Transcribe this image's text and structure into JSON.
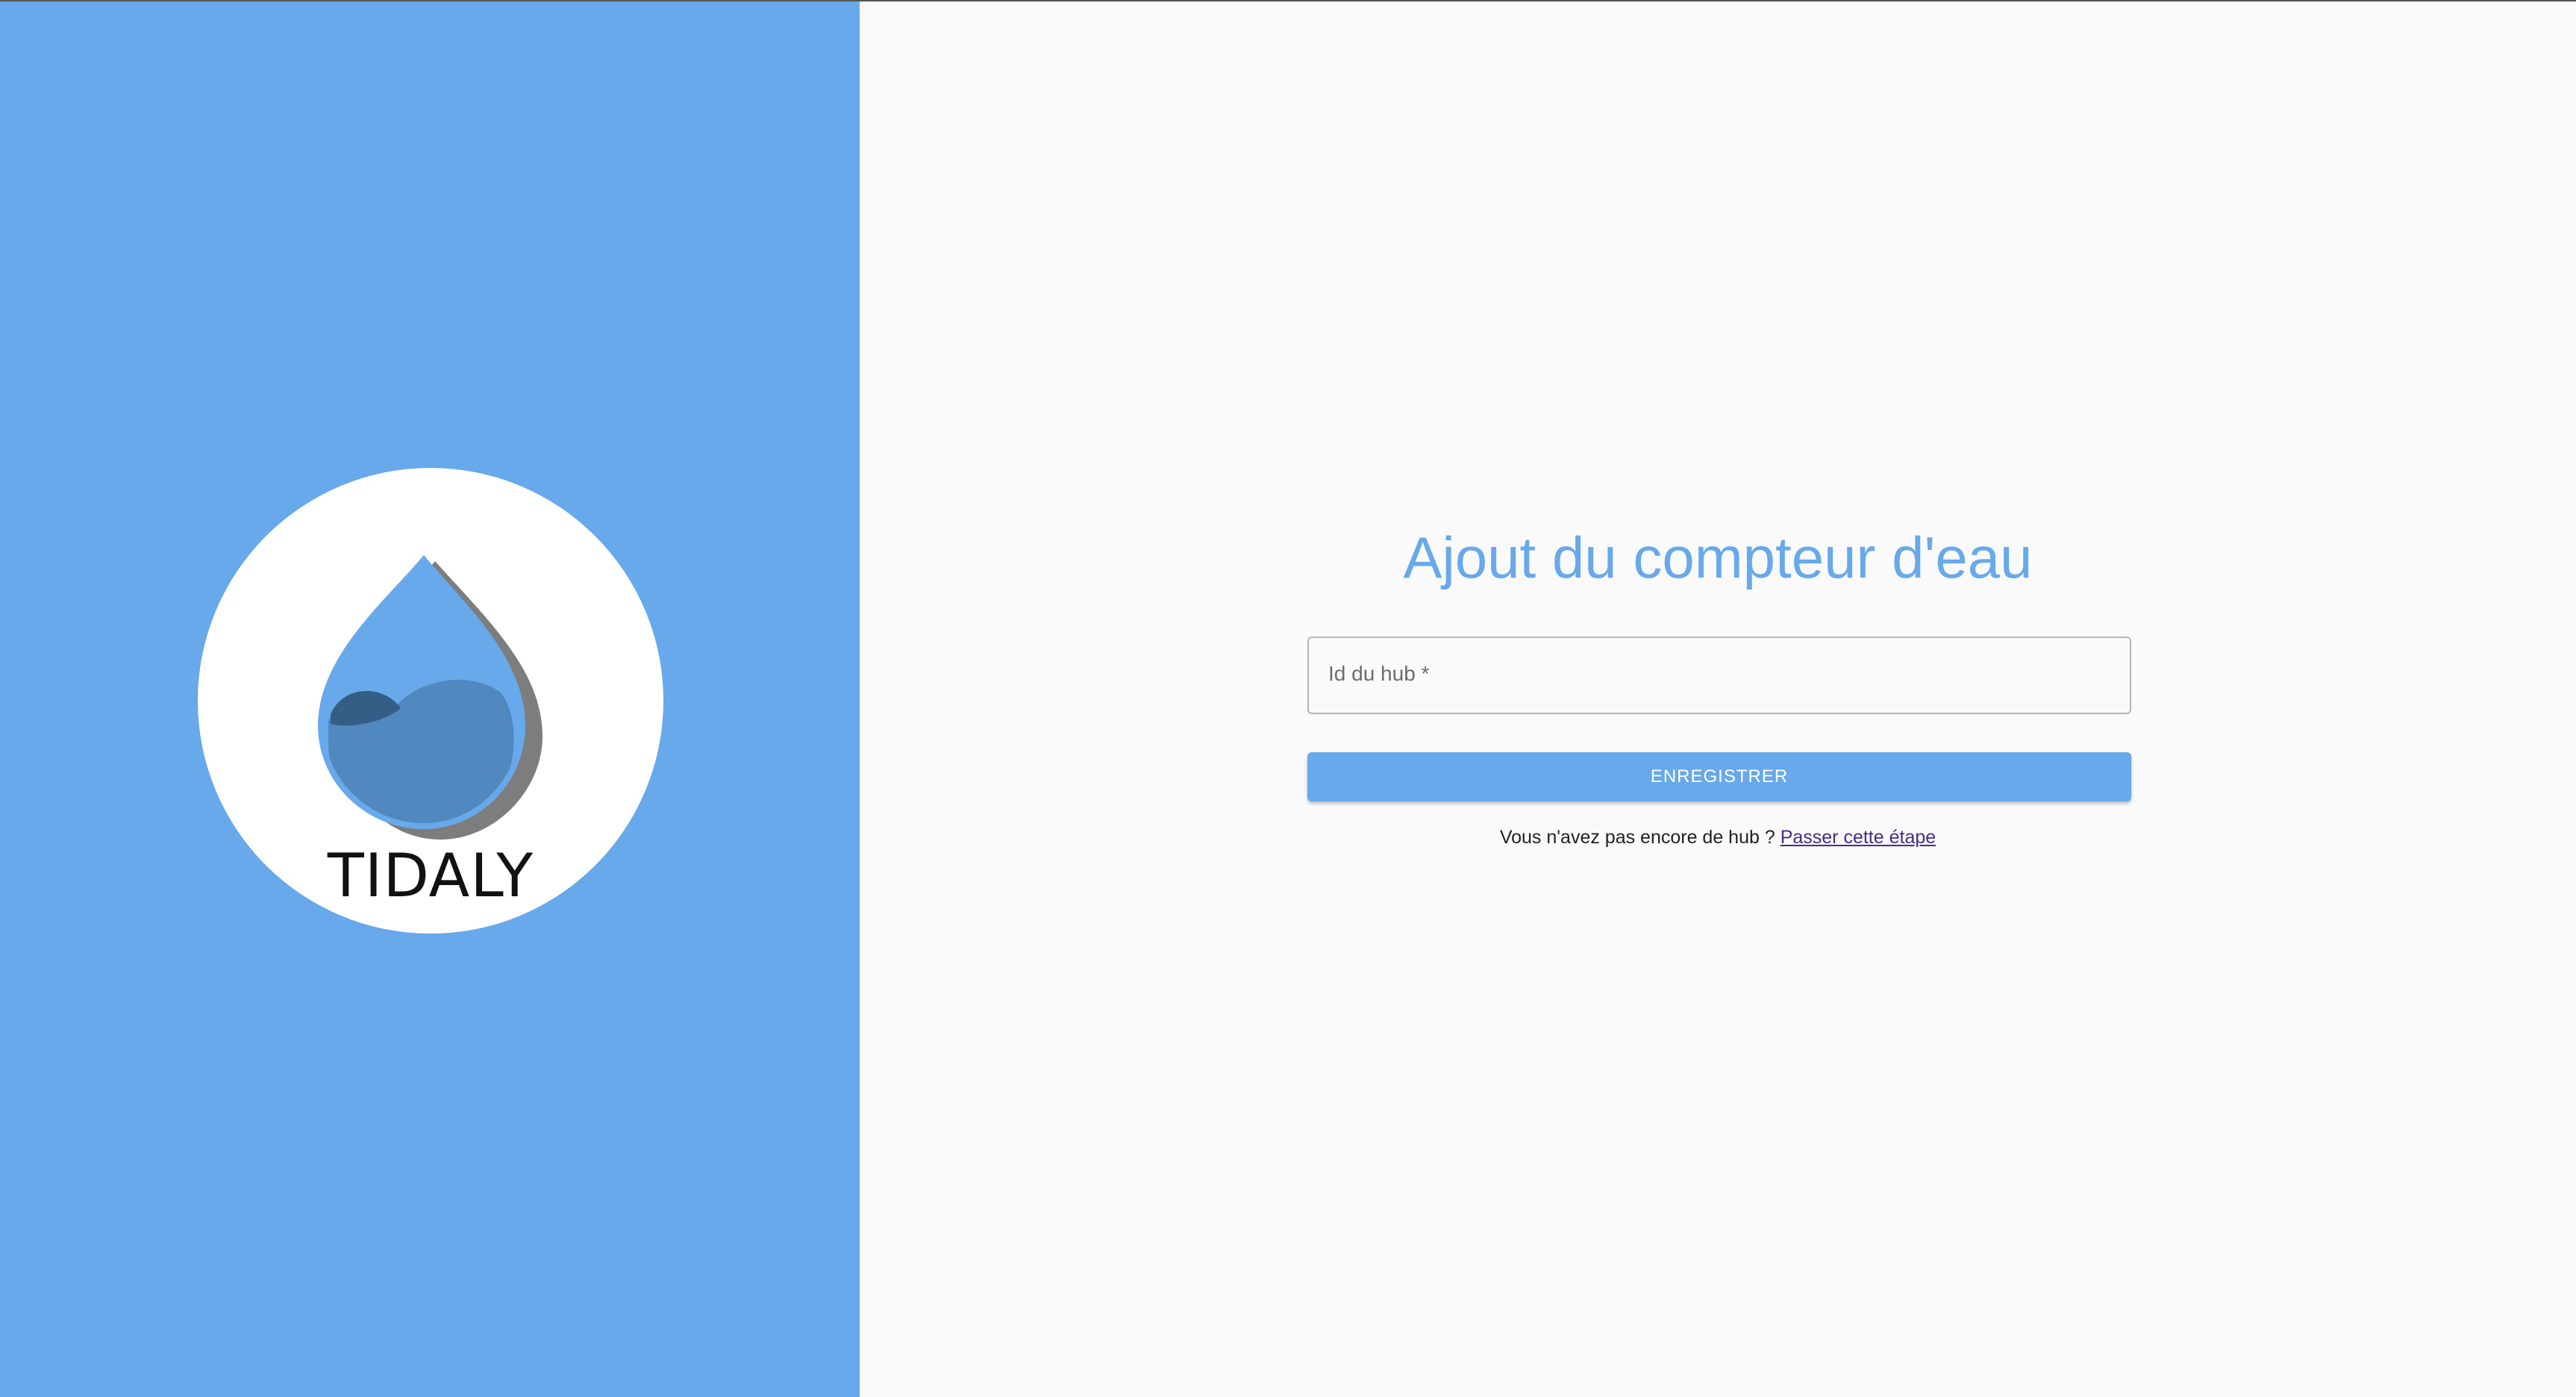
{
  "brand": {
    "name": "TIDALY",
    "primary_color": "#67a9ea",
    "logo_icon": "water-drop-icon"
  },
  "form": {
    "title": "Ajout du compteur d'eau",
    "hub_field": {
      "label": "Id du hub *",
      "value": ""
    },
    "save_label": "ENREGISTRER",
    "helper_text": "Vous n'avez pas encore de hub ? ",
    "skip_link": "Passer cette étape"
  }
}
